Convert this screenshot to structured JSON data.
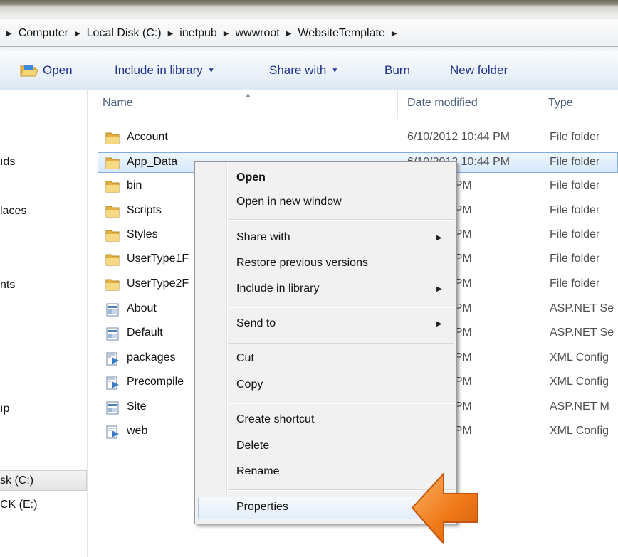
{
  "breadcrumb": [
    "Computer",
    "Local Disk (C:)",
    "inetpub",
    "wwwroot",
    "WebsiteTemplate"
  ],
  "toolbar": {
    "open_label": "Open",
    "include_label": "Include in library",
    "share_label": "Share with",
    "burn_label": "Burn",
    "new_folder_label": "New folder"
  },
  "left_pane": {
    "items": [
      "ıds",
      "laces",
      "nts",
      "ıp",
      "sk (C:)",
      "CK (E:)"
    ]
  },
  "columns": {
    "name": "Name",
    "date": "Date modified",
    "type": "Type"
  },
  "files": [
    {
      "name": "Account",
      "date": "6/10/2012 10:44 PM",
      "type": "File folder",
      "icon": "folder-icon"
    },
    {
      "name": "App_Data",
      "date": "6/10/2012 10:44 PM",
      "type": "File folder",
      "icon": "folder-icon"
    },
    {
      "name": "bin",
      "date": "12 10:44 PM",
      "type": "File folder",
      "icon": "folder-icon"
    },
    {
      "name": "Scripts",
      "date": "12 10:44 PM",
      "type": "File folder",
      "icon": "folder-icon"
    },
    {
      "name": "Styles",
      "date": "12 10:44 PM",
      "type": "File folder",
      "icon": "folder-icon"
    },
    {
      "name": "UserType1F",
      "date": "12 10:44 PM",
      "type": "File folder",
      "icon": "folder-icon"
    },
    {
      "name": "UserType2F",
      "date": "12 10:44 PM",
      "type": "File folder",
      "icon": "folder-icon"
    },
    {
      "name": "About",
      "date": "12 10:44 PM",
      "type": "ASP.NET Se",
      "icon": "aspx-file-icon"
    },
    {
      "name": "Default",
      "date": "12 10:44 PM",
      "type": "ASP.NET Se",
      "icon": "aspx-file-icon"
    },
    {
      "name": "packages",
      "date": "12 10:03 PM",
      "type": "XML Config",
      "icon": "config-file-icon"
    },
    {
      "name": "Precompile",
      "date": "12 10:44 PM",
      "type": "XML Config",
      "icon": "config-file-icon"
    },
    {
      "name": "Site",
      "date": "12 10:44 PM",
      "type": "ASP.NET M",
      "icon": "aspx-file-icon"
    },
    {
      "name": "web",
      "date": "12 10:02 PM",
      "type": "XML Config",
      "icon": "config-file-icon"
    }
  ],
  "context_menu": {
    "open": "Open",
    "open_new_window": "Open in new window",
    "share_with": "Share with",
    "restore": "Restore previous versions",
    "include_library": "Include in library",
    "send_to": "Send to",
    "cut": "Cut",
    "copy": "Copy",
    "create_shortcut": "Create shortcut",
    "delete": "Delete",
    "rename": "Rename",
    "properties": "Properties"
  },
  "colors": {
    "accent_arrow": "#f07a1a",
    "selection": "#d6e9fb",
    "link_text": "#1e3287"
  }
}
